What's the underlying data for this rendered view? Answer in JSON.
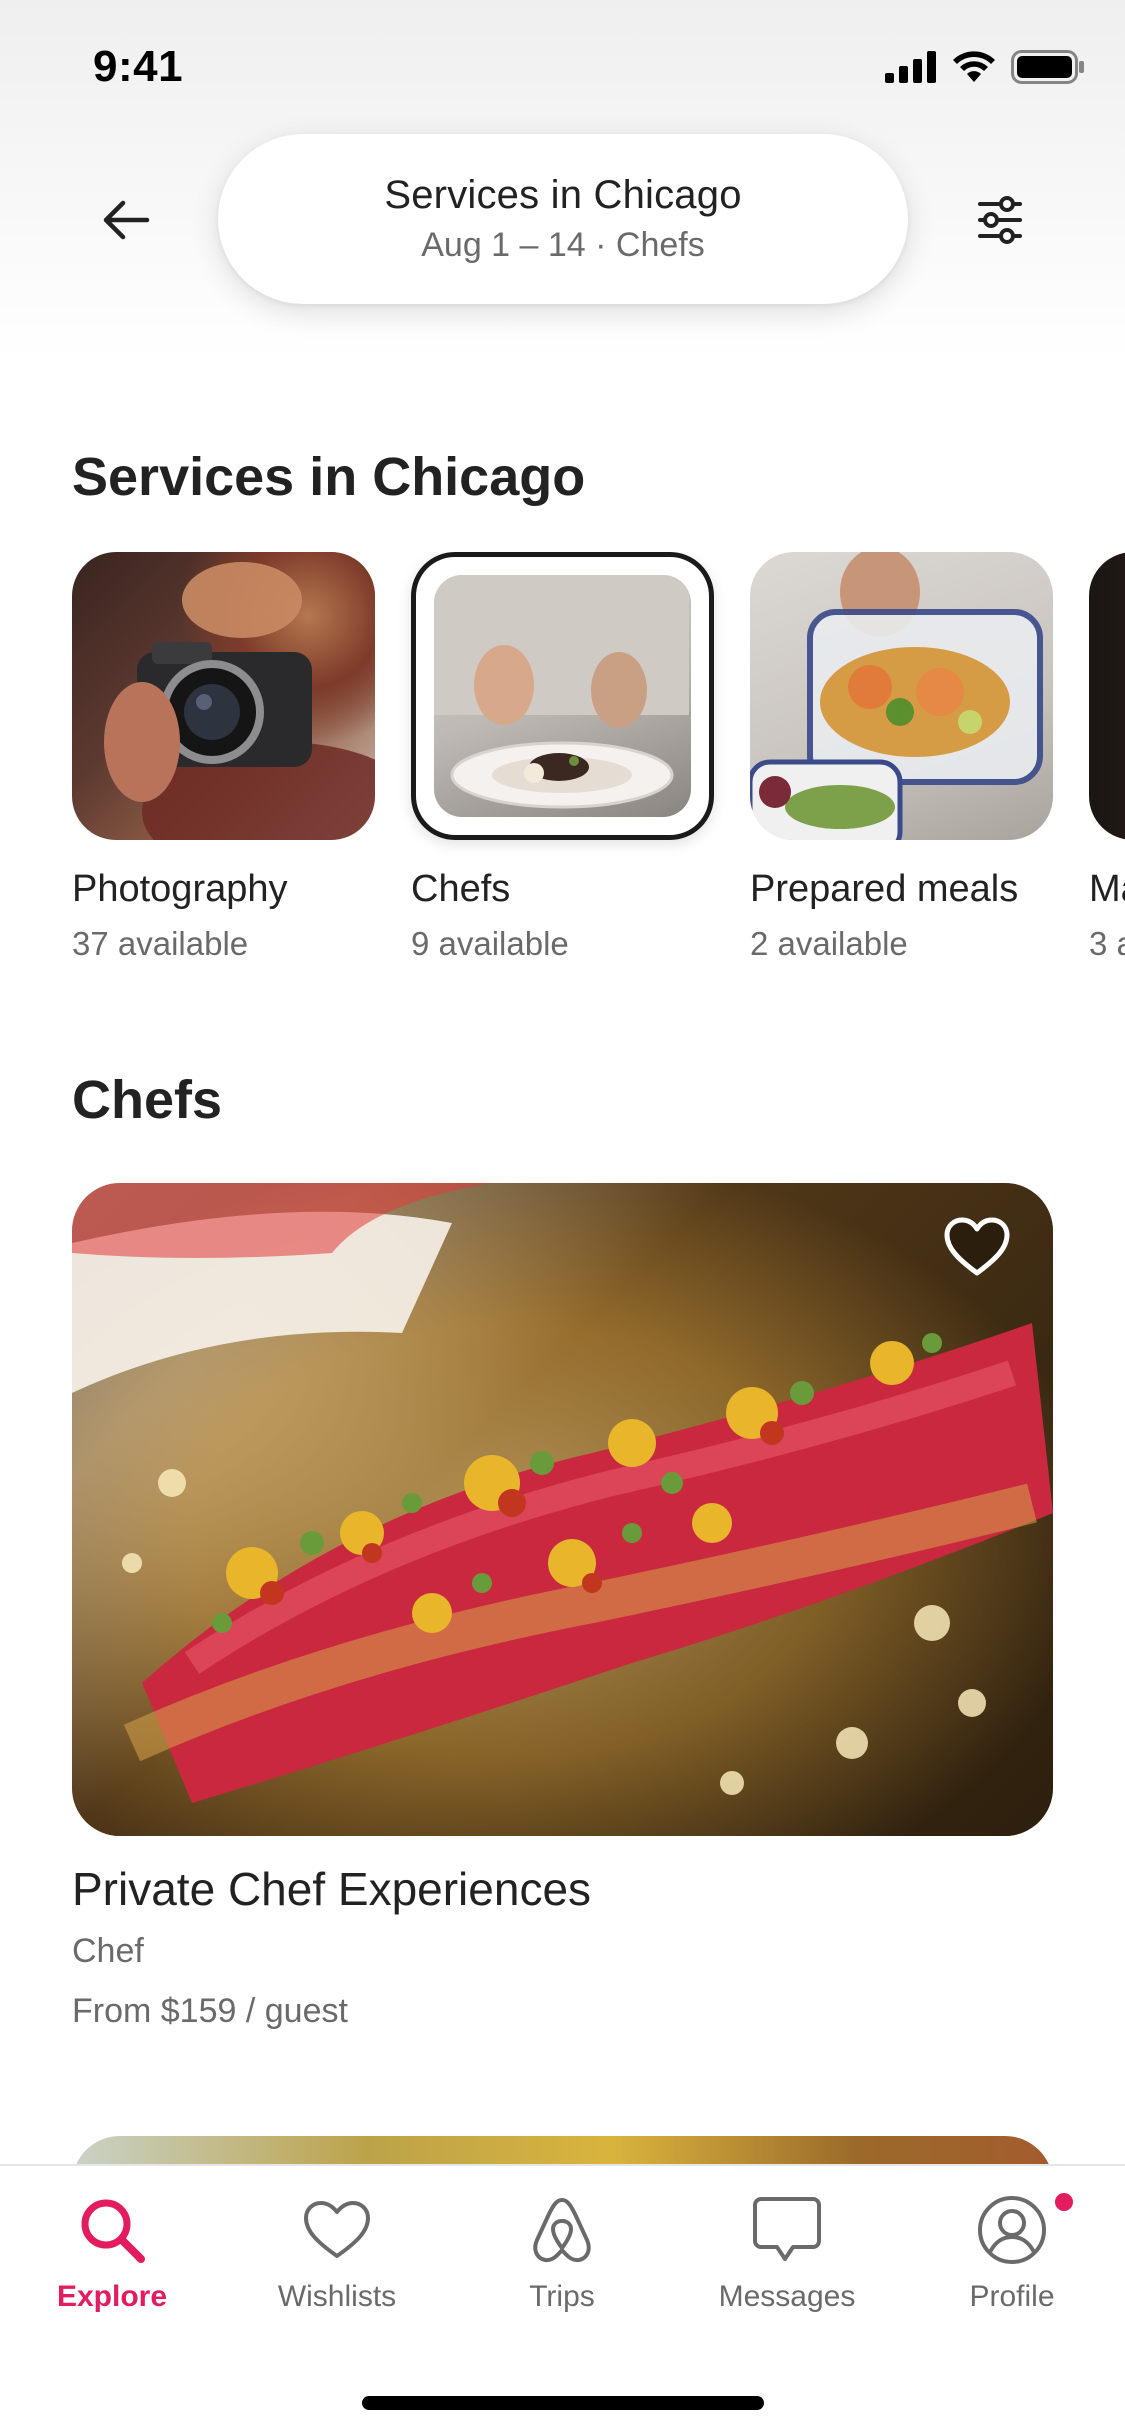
{
  "status_bar": {
    "time": "9:41",
    "icons": [
      "cellular-signal-icon",
      "wifi-icon",
      "battery-icon"
    ]
  },
  "header": {
    "back_icon": "arrow-left-icon",
    "search_title": "Services in Chicago",
    "search_subtitle": "Aug 1 – 14 · Chefs",
    "filter_icon": "sliders-icon"
  },
  "services": {
    "title": "Services in Chicago",
    "categories": [
      {
        "label": "Photography",
        "count": "37 available",
        "selected": false
      },
      {
        "label": "Chefs",
        "count": "9 available",
        "selected": true
      },
      {
        "label": "Prepared meals",
        "count": "2 available",
        "selected": false
      },
      {
        "label": "Ma",
        "count": "3 a",
        "selected": false
      }
    ]
  },
  "chefs_section": {
    "title": "Chefs",
    "listing": {
      "title": "Private Chef Experiences",
      "category": "Chef",
      "price": "From $159 / guest",
      "favorite_icon": "heart-outline-icon"
    }
  },
  "tab_bar": {
    "tabs": [
      {
        "label": "Explore",
        "icon": "search-icon",
        "active": true
      },
      {
        "label": "Wishlists",
        "icon": "heart-icon",
        "active": false
      },
      {
        "label": "Trips",
        "icon": "airbnb-logo-icon",
        "active": false
      },
      {
        "label": "Messages",
        "icon": "message-icon",
        "active": false
      },
      {
        "label": "Profile",
        "icon": "profile-icon",
        "active": false
      }
    ]
  },
  "colors": {
    "accent": "#e31c5f",
    "text_primary": "#222222",
    "text_secondary": "#6a6a6a"
  }
}
